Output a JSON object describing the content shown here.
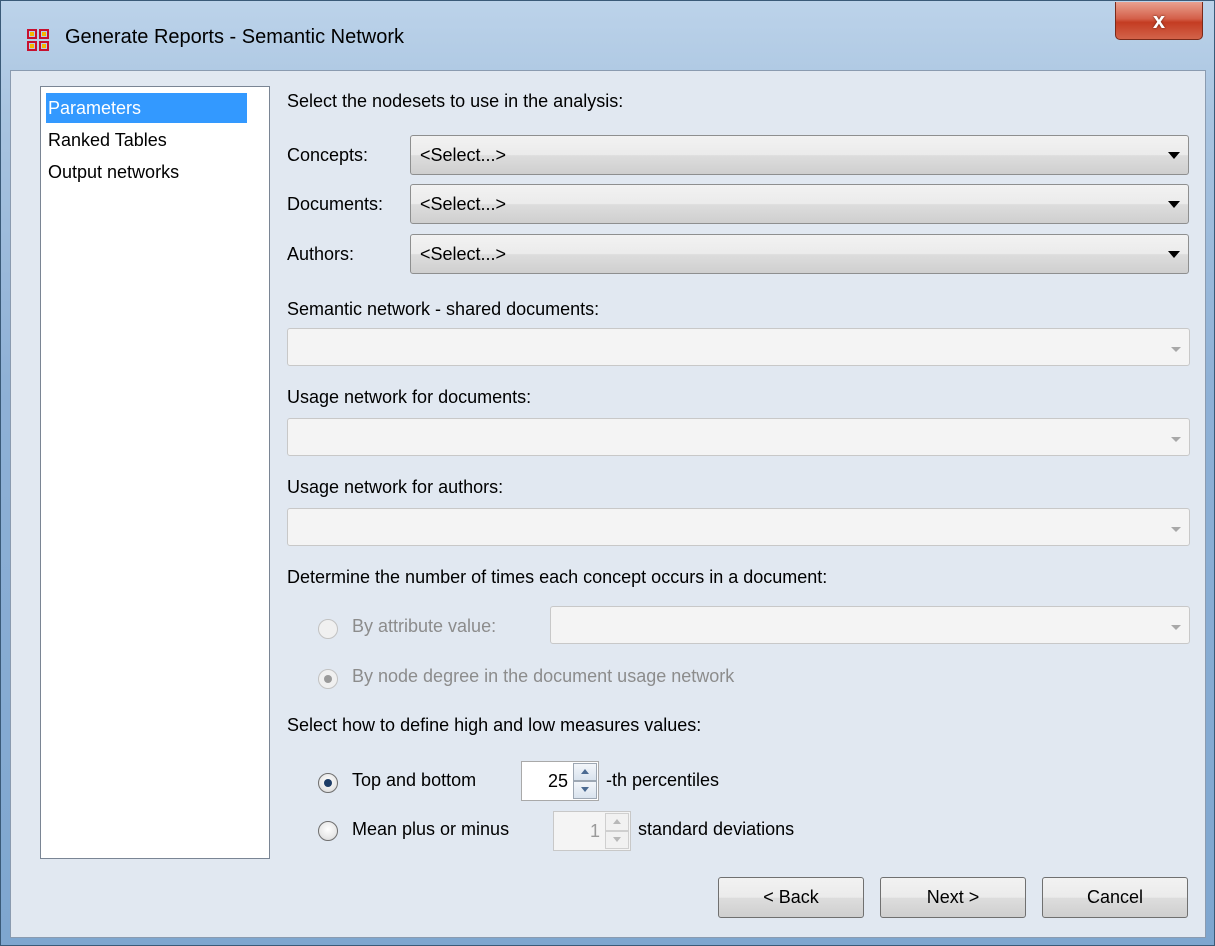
{
  "window": {
    "title": "Generate Reports - Semantic Network",
    "close_label": "x"
  },
  "nav": {
    "items": [
      {
        "label": "Parameters",
        "selected": true
      },
      {
        "label": "Ranked Tables",
        "selected": false
      },
      {
        "label": "Output networks",
        "selected": false
      }
    ]
  },
  "params": {
    "heading": "Select the nodesets to use in the analysis:",
    "concepts": {
      "label": "Concepts:",
      "value": "<Select...>"
    },
    "documents": {
      "label": "Documents:",
      "value": "<Select...>"
    },
    "authors": {
      "label": "Authors:",
      "value": "<Select...>"
    },
    "semantic_label": "Semantic network - shared documents:",
    "semantic_value": "",
    "usage_docs_label": "Usage network for documents:",
    "usage_docs_value": "",
    "usage_authors_label": "Usage network for authors:",
    "usage_authors_value": "",
    "occurs_heading": "Determine the number of times each concept occurs in a document:",
    "by_attribute_label": "By attribute value:",
    "by_attribute_value": "",
    "by_degree_label": "By node degree in the document usage network",
    "measures_heading": "Select how to define high and low measures values:",
    "top_bottom_label": "Top and bottom",
    "top_bottom_value": "25",
    "percentiles_suffix": "-th percentiles",
    "mean_label": "Mean plus or minus",
    "mean_value": "1",
    "std_suffix": "standard deviations"
  },
  "buttons": {
    "back_label": "< Back",
    "next_label": "Next >",
    "cancel_label": "Cancel"
  }
}
